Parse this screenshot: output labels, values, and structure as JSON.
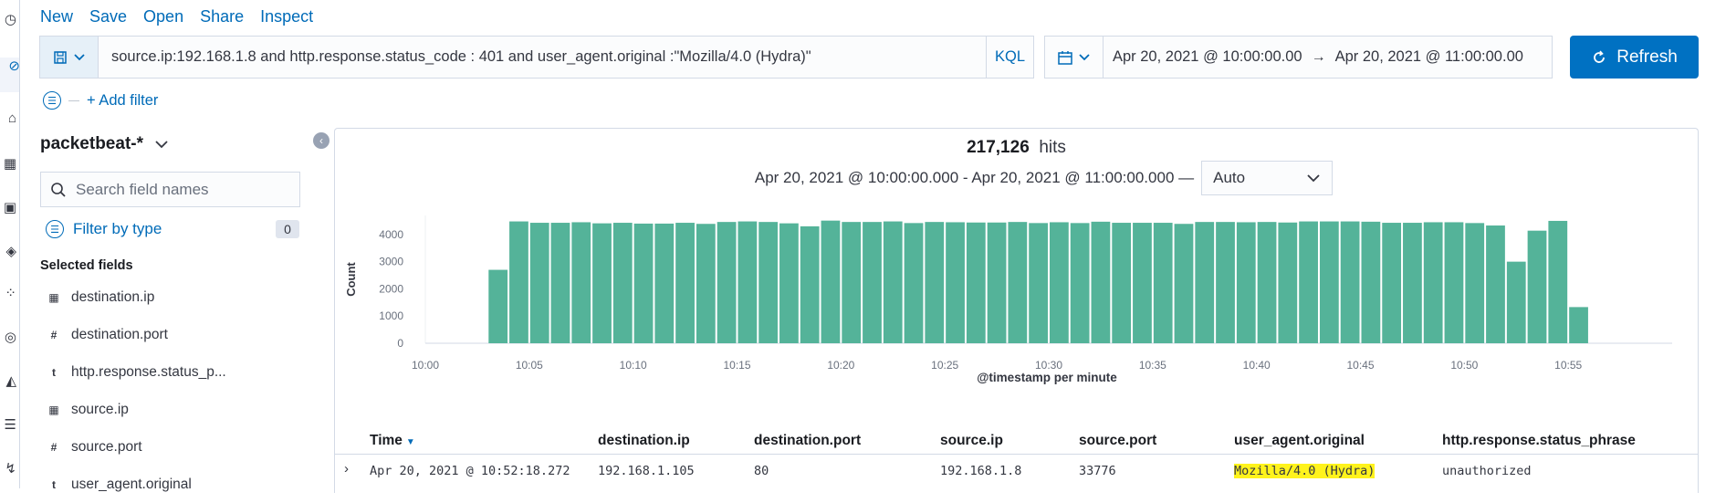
{
  "top_menu": [
    "New",
    "Save",
    "Open",
    "Share",
    "Inspect"
  ],
  "query": {
    "text": "source.ip:192.168.1.8 and http.response.status_code : 401 and user_agent.original :\"Mozilla/4.0 (Hydra)\"",
    "language": "KQL"
  },
  "time_range": {
    "start": "Apr 20, 2021 @ 10:00:00.00",
    "arrow": "→",
    "end": "Apr 20, 2021 @ 11:00:00.00"
  },
  "refresh_label": "Refresh",
  "filters": {
    "add_label": "+ Add filter"
  },
  "sidebar": {
    "index_pattern": "packetbeat-*",
    "search_placeholder": "Search field names",
    "filter_by_type": "Filter by type",
    "filter_count": "0",
    "selected_title": "Selected fields",
    "fields": [
      {
        "type": "ip",
        "name": "destination.ip"
      },
      {
        "type": "#",
        "name": "destination.port"
      },
      {
        "type": "t",
        "name": "http.response.status_p..."
      },
      {
        "type": "ip",
        "name": "source.ip"
      },
      {
        "type": "#",
        "name": "source.port"
      },
      {
        "type": "t",
        "name": "user_agent.original"
      }
    ]
  },
  "hits": {
    "count": "217,126",
    "label": "hits"
  },
  "range_label": "Apr 20, 2021 @ 10:00:00.000 - Apr 20, 2021 @ 11:00:00.000 —",
  "interval": "Auto",
  "chart_data": {
    "type": "bar",
    "xlabel": "@timestamp per minute",
    "ylabel": "Count",
    "yticks": [
      0,
      1000,
      2000,
      3000,
      4000
    ],
    "ylim": [
      0,
      4700
    ],
    "xticks": [
      "10:00",
      "10:05",
      "10:10",
      "10:15",
      "10:20",
      "10:25",
      "10:30",
      "10:35",
      "10:40",
      "10:45",
      "10:50",
      "10:55"
    ],
    "xlim": [
      0,
      60
    ],
    "bar_color": "#54b399",
    "minutes": [
      3,
      4,
      5,
      6,
      7,
      8,
      9,
      10,
      11,
      12,
      13,
      14,
      15,
      16,
      17,
      18,
      19,
      20,
      21,
      22,
      23,
      24,
      25,
      26,
      27,
      28,
      29,
      30,
      31,
      32,
      33,
      34,
      35,
      36,
      37,
      38,
      39,
      40,
      41,
      42,
      43,
      44,
      45,
      46,
      47,
      48,
      49,
      50,
      51,
      52
    ],
    "values": [
      2700,
      4480,
      4430,
      4430,
      4450,
      4410,
      4430,
      4400,
      4400,
      4430,
      4390,
      4460,
      4480,
      4460,
      4410,
      4300,
      4510,
      4460,
      4460,
      4480,
      4420,
      4460,
      4450,
      4440,
      4440,
      4460,
      4420,
      4450,
      4420,
      4470,
      4430,
      4430,
      4430,
      4390,
      4460,
      4460,
      4450,
      4460,
      4440,
      4480,
      4480,
      4480,
      4470,
      4430,
      4430,
      4450,
      4450,
      4420,
      4330,
      3000,
      4140,
      4500,
      1330
    ]
  },
  "table": {
    "columns": [
      "Time",
      "destination.ip",
      "destination.port",
      "source.ip",
      "source.port",
      "user_agent.original",
      "http.response.status_phrase"
    ],
    "rows": [
      [
        "Apr 20, 2021 @ 10:52:18.272",
        "192.168.1.105",
        "80",
        "192.168.1.8",
        "33776",
        "Mozilla/4.0 (Hydra)",
        "unauthorized"
      ]
    ]
  }
}
